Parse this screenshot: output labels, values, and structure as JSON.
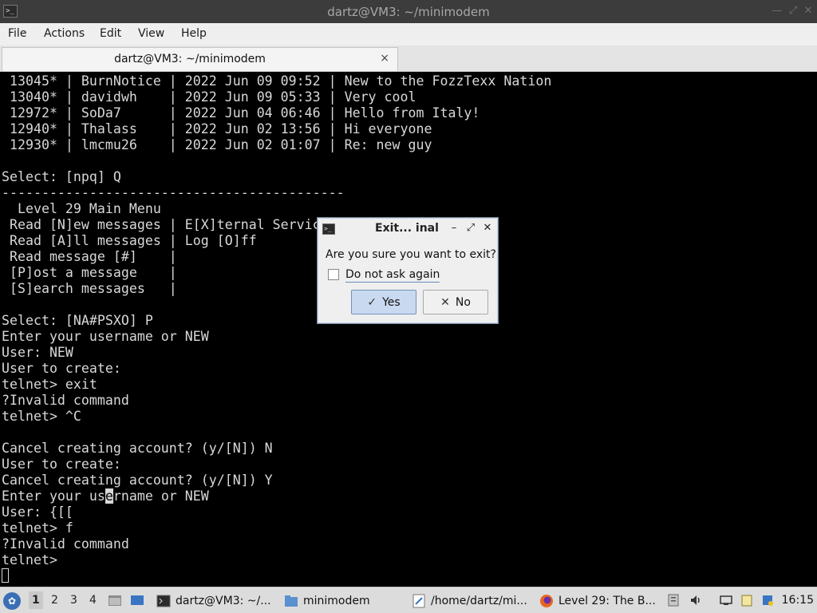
{
  "window": {
    "title": "dartz@VM3: ~/minimodem",
    "controls": [
      "minimize",
      "maximize",
      "close"
    ]
  },
  "menubar": {
    "items": [
      "File",
      "Actions",
      "Edit",
      "View",
      "Help"
    ]
  },
  "tabs": [
    {
      "label": "dartz@VM3: ~/minimodem",
      "close": "×"
    }
  ],
  "terminal": {
    "lines": [
      " 13045* | BurnNotice | 2022 Jun 09 09:52 | New to the FozzTexx Nation",
      " 13040* | davidwh    | 2022 Jun 09 05:33 | Very cool",
      " 12972* | SoDa7      | 2022 Jun 04 06:46 | Hello from Italy!",
      " 12940* | Thalass    | 2022 Jun 02 13:56 | Hi everyone",
      " 12930* | lmcmu26    | 2022 Jun 02 01:07 | Re: new guy",
      "",
      "Select: [npq] Q",
      "-------------------------------------------",
      "  Level 29 Main Menu",
      " Read [N]ew messages | E[X]ternal Services",
      " Read [A]ll messages | Log [O]ff",
      " Read message [#]    |",
      " [P]ost a message    |",
      " [S]earch messages   |",
      "",
      "Select: [NA#PSXO] P",
      "Enter your username or NEW",
      "User: NEW",
      "User to create:",
      "telnet> exit",
      "?Invalid command",
      "telnet> ^C",
      "",
      "Cancel creating account? (y/[N]) N",
      "User to create:",
      "Cancel creating account? (y/[N]) Y",
      "Enter your username or NEW",
      "User: {[[",
      "telnet> f",
      "?Invalid command",
      "telnet> "
    ],
    "cursor_line_prefix": "Enter your us",
    "cursor_char": "e",
    "cursor_line_suffix": "rname or NEW"
  },
  "dialog": {
    "title": "Exit... inal",
    "question": "Are you sure you want to exit?",
    "checkbox_label": "Do not ask again",
    "checkbox_checked": false,
    "yes_label": "Yes",
    "no_label": "No",
    "yes_icon": "check-icon",
    "no_icon": "cross-icon"
  },
  "taskbar": {
    "workspaces": [
      "1",
      "2",
      "3",
      "4"
    ],
    "active_workspace": "1",
    "tasks": [
      {
        "label": "dartz@VM3: ~/...",
        "icon": "terminal-icon"
      },
      {
        "label": "minimodem",
        "icon": "folder-icon"
      },
      {
        "label": "/home/dartz/mi...",
        "icon": "text-editor-icon"
      },
      {
        "label": "Level 29: The B...",
        "icon": "firefox-icon"
      }
    ],
    "clock": "16:15"
  },
  "colors": {
    "terminal_bg": "#000000",
    "terminal_fg": "#d8d8d8",
    "titlebar_bg": "#3c3c3c",
    "accent": "#c9daf0"
  }
}
